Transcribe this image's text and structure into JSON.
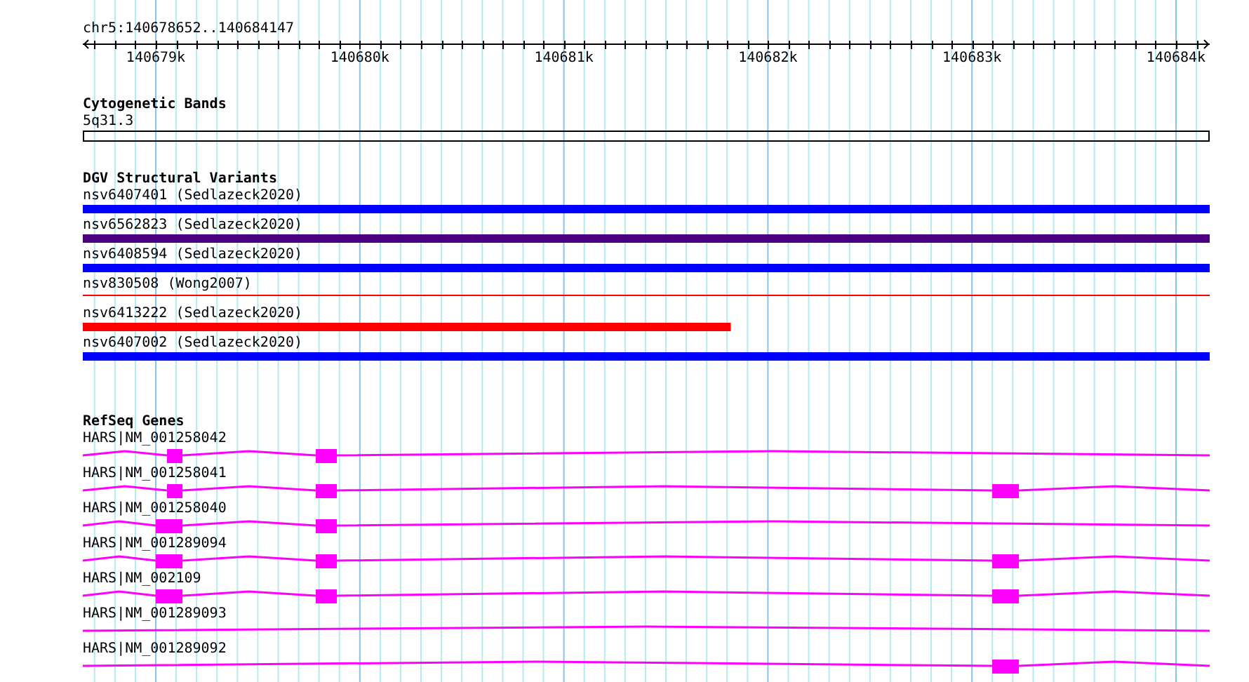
{
  "ruler": {
    "location": "chr5:140678652..140684147",
    "ticks": [
      "140679k",
      "140680k",
      "140681k",
      "140682k",
      "140683k",
      "140684k"
    ]
  },
  "tracks": [
    {
      "kind": "bands",
      "title": "Cytogenetic Bands",
      "features": [
        {
          "label": "5q31.3"
        }
      ]
    },
    {
      "kind": "variants",
      "title": "DGV Structural Variants",
      "features": [
        {
          "label": "nsv6407401 (Sedlazeck2020)",
          "kind": "bar",
          "color": "#0000ff"
        },
        {
          "label": "nsv6562823 (Sedlazeck2020)",
          "kind": "bar",
          "color": "#4b0082"
        },
        {
          "label": "nsv6408594 (Sedlazeck2020)",
          "kind": "bar",
          "color": "#0000ff"
        },
        {
          "label": "nsv830508 (Wong2007)",
          "kind": "line",
          "color": "#ff0000"
        },
        {
          "label": "nsv6413222 (Sedlazeck2020)",
          "kind": "bar",
          "color": "#ff0000"
        },
        {
          "label": "nsv6407002 (Sedlazeck2020)",
          "kind": "bar",
          "color": "#0000ff"
        }
      ]
    },
    {
      "kind": "genes",
      "title": "RefSeq Genes",
      "features": [
        {
          "label": "HARS|NM_001258042"
        },
        {
          "label": "HARS|NM_001258041"
        },
        {
          "label": "HARS|NM_001258040"
        },
        {
          "label": "HARS|NM_001289094"
        },
        {
          "label": "HARS|NM_002109"
        },
        {
          "label": "HARS|NM_001289093"
        },
        {
          "label": "HARS|NM_001289092"
        }
      ]
    }
  ]
}
